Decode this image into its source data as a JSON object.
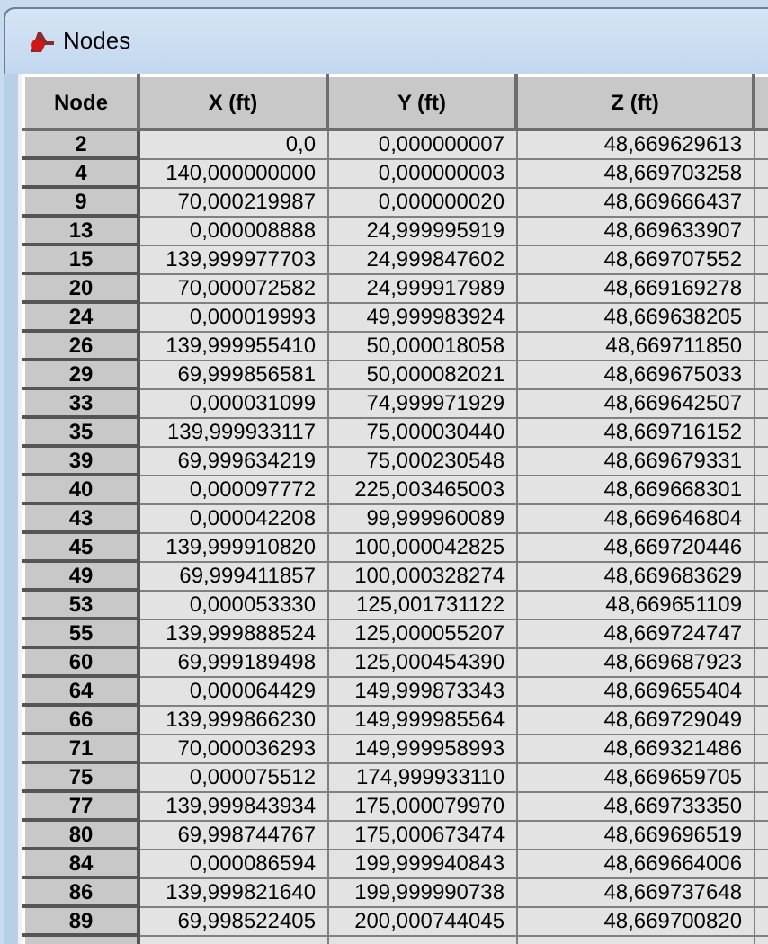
{
  "window": {
    "title": "Nodes"
  },
  "table": {
    "columns": [
      "Node",
      "X (ft)",
      "Y (ft)",
      "Z (ft)"
    ],
    "rows": [
      [
        "2",
        "0,0",
        "0,000000007",
        "48,669629613"
      ],
      [
        "4",
        "140,000000000",
        "0,000000003",
        "48,669703258"
      ],
      [
        "9",
        "70,000219987",
        "0,000000020",
        "48,669666437"
      ],
      [
        "13",
        "0,000008888",
        "24,999995919",
        "48,669633907"
      ],
      [
        "15",
        "139,999977703",
        "24,999847602",
        "48,669707552"
      ],
      [
        "20",
        "70,000072582",
        "24,999917989",
        "48,669169278"
      ],
      [
        "24",
        "0,000019993",
        "49,999983924",
        "48,669638205"
      ],
      [
        "26",
        "139,999955410",
        "50,000018058",
        "48,669711850"
      ],
      [
        "29",
        "69,999856581",
        "50,000082021",
        "48,669675033"
      ],
      [
        "33",
        "0,000031099",
        "74,999971929",
        "48,669642507"
      ],
      [
        "35",
        "139,999933117",
        "75,000030440",
        "48,669716152"
      ],
      [
        "39",
        "69,999634219",
        "75,000230548",
        "48,669679331"
      ],
      [
        "40",
        "0,000097772",
        "225,003465003",
        "48,669668301"
      ],
      [
        "43",
        "0,000042208",
        "99,999960089",
        "48,669646804"
      ],
      [
        "45",
        "139,999910820",
        "100,000042825",
        "48,669720446"
      ],
      [
        "49",
        "69,999411857",
        "100,000328274",
        "48,669683629"
      ],
      [
        "53",
        "0,000053330",
        "125,001731122",
        "48,669651109"
      ],
      [
        "55",
        "139,999888524",
        "125,000055207",
        "48,669724747"
      ],
      [
        "60",
        "69,999189498",
        "125,000454390",
        "48,669687923"
      ],
      [
        "64",
        "0,000064429",
        "149,999873343",
        "48,669655404"
      ],
      [
        "66",
        "139,999866230",
        "149,999985564",
        "48,669729049"
      ],
      [
        "71",
        "70,000036293",
        "149,999958993",
        "48,669321486"
      ],
      [
        "75",
        "0,000075512",
        "174,999933110",
        "48,669659705"
      ],
      [
        "77",
        "139,999843934",
        "175,000079970",
        "48,669733350"
      ],
      [
        "80",
        "69,998744767",
        "175,000673474",
        "48,669696519"
      ],
      [
        "84",
        "0,000086594",
        "199,999940843",
        "48,669664006"
      ],
      [
        "86",
        "139,999821640",
        "199,999990738",
        "48,669737648"
      ],
      [
        "89",
        "69,998522405",
        "200,000744045",
        "48,669700820"
      ]
    ]
  }
}
